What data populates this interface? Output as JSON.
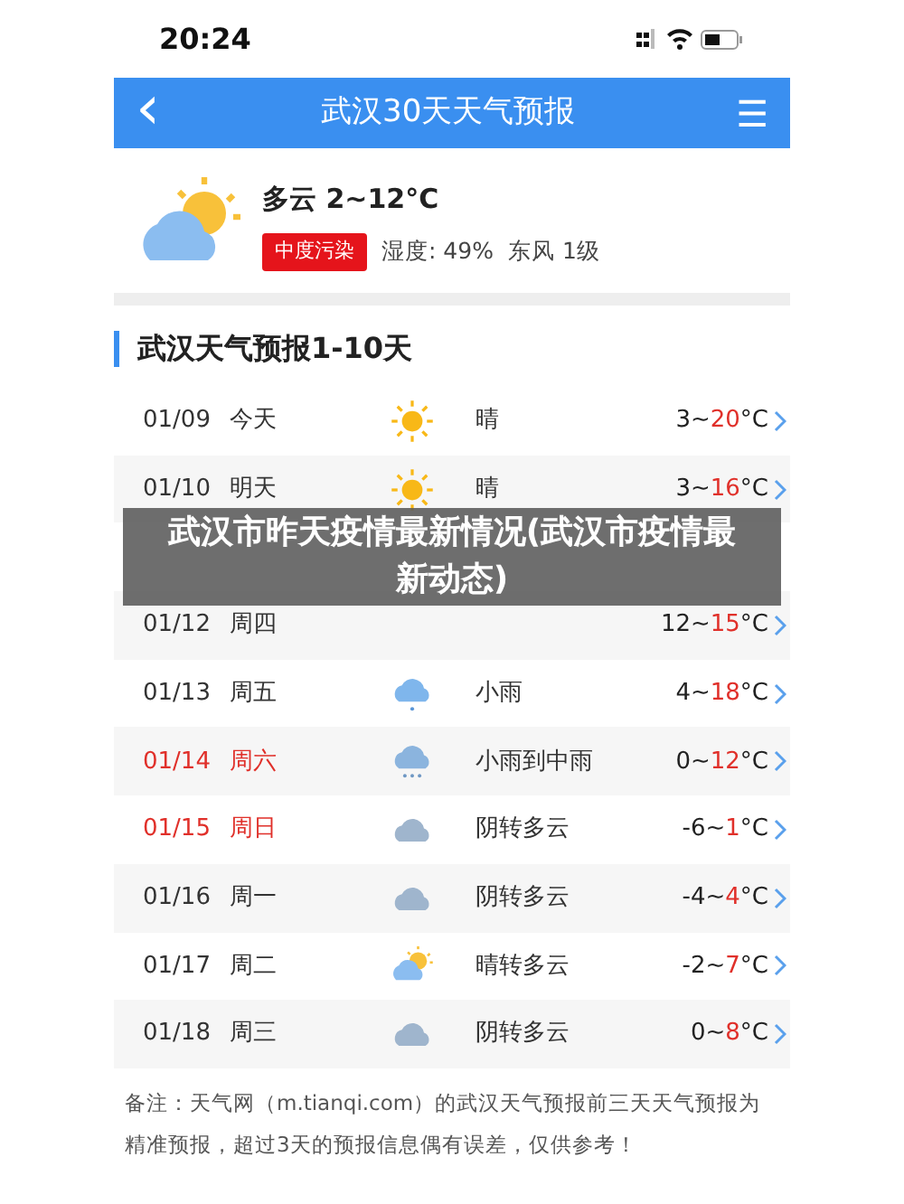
{
  "status_bar": {
    "time": "20:24"
  },
  "header": {
    "back": "‹",
    "title": "武汉30天天气预报",
    "menu": "☰"
  },
  "current": {
    "kind": "partly-cloudy",
    "summary": "多云 2~12°C",
    "air_quality": "中度污染",
    "humidity": "湿度: 49%",
    "wind": "东风 1级"
  },
  "section_title": "武汉天气预报1-10天",
  "days": [
    {
      "date": "01/09",
      "day": "今天",
      "kind": "sunny",
      "condition": "晴",
      "low": "3~",
      "high": "20",
      "unit": "°C",
      "weekend": false
    },
    {
      "date": "01/10",
      "day": "明天",
      "kind": "sunny",
      "condition": "晴",
      "low": "3~",
      "high": "16",
      "unit": "°C",
      "weekend": false
    },
    {
      "kind": "covered"
    },
    {
      "date": "01/12",
      "day": "周四",
      "low": "12~",
      "high": "15",
      "unit": "°C",
      "weekend": false
    },
    {
      "date": "01/13",
      "day": "周五",
      "kind": "rain",
      "condition": "小雨",
      "low": "4~",
      "high": "18",
      "unit": "°C",
      "weekend": false
    },
    {
      "date": "01/14",
      "day": "周六",
      "kind": "heavy-rain",
      "condition": "小雨到中雨",
      "low": "0~",
      "high": "12",
      "unit": "°C",
      "weekend": true
    },
    {
      "date": "01/15",
      "day": "周日",
      "kind": "overcast",
      "condition": "阴转多云",
      "low": "-6~",
      "high": "1",
      "unit": "°C",
      "weekend": true
    },
    {
      "date": "01/16",
      "day": "周一",
      "kind": "overcast",
      "condition": "阴转多云",
      "low": "-4~",
      "high": "4",
      "unit": "°C",
      "weekend": false
    },
    {
      "date": "01/17",
      "day": "周二",
      "kind": "partly-cloudy",
      "condition": "晴转多云",
      "low": "-2~",
      "high": "7",
      "unit": "°C",
      "weekend": false
    },
    {
      "date": "01/18",
      "day": "周三",
      "kind": "overcast",
      "condition": "阴转多云",
      "low": "0~",
      "high": "8",
      "unit": "°C",
      "weekend": false
    }
  ],
  "note": "备注：天气网（m.tianqi.com）的武汉天气预报前三天天气预报为精准预报，超过3天的预报信息偶有误差，仅供参考！",
  "overlay_caption": "武汉市昨天疫情最新情况(武汉市疫情最新动态)"
}
